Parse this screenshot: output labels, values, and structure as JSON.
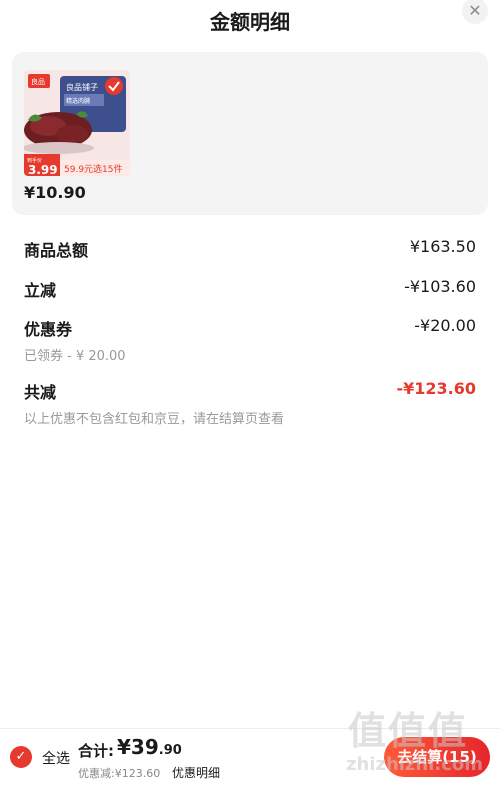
{
  "header": {
    "title": "金额明细"
  },
  "product": {
    "brand_badge": "良品",
    "pkg_text_1": "良品铺子",
    "pkg_text_2": "精选肉脯",
    "price_tag_top": "到手价",
    "price_tag_value": "3.99",
    "promo_label": "59.9元选15件",
    "price": "¥10.90"
  },
  "summary": {
    "goods_total": {
      "label": "商品总额",
      "amount": "¥163.50"
    },
    "instant_discount": {
      "label": "立减",
      "amount": "-¥103.60"
    },
    "coupon": {
      "label": "优惠券",
      "amount": "-¥20.00",
      "note": "已领券 - ¥ 20.00"
    },
    "total_discount": {
      "label": "共减",
      "amount": "-¥123.60",
      "note": "以上优惠不包含红包和京豆，请在结算页查看"
    }
  },
  "bottom_bar": {
    "select_all": "全选",
    "total_label": "合计:",
    "total_int": "¥39",
    "total_dec": ".90",
    "discount_note": "优惠减:¥123.60",
    "detail_link": "优惠明细",
    "checkout_label": "去结算(15)"
  },
  "watermark": {
    "text": "值值值",
    "url": "zhizhizhi.com"
  },
  "colors": {
    "accent_red": "#e63a2e",
    "card_bg": "#f4f4f4",
    "muted_text": "#999999"
  }
}
